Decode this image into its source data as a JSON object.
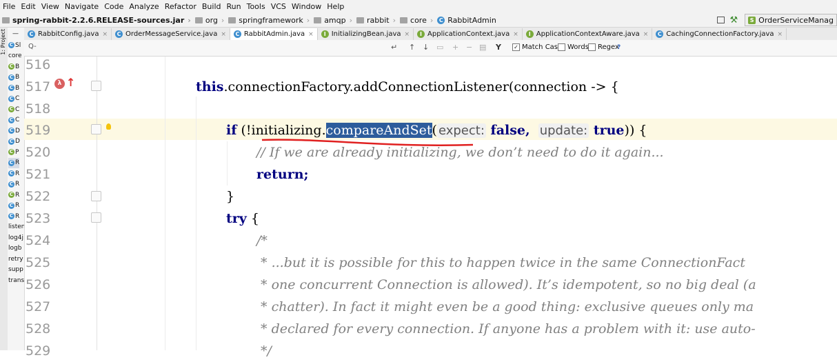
{
  "menu": [
    "File",
    "Edit",
    "View",
    "Navigate",
    "Code",
    "Analyze",
    "Refactor",
    "Build",
    "Run",
    "Tools",
    "VCS",
    "Window",
    "Help"
  ],
  "breadcrumbs": [
    "spring-rabbit-2.2.6.RELEASE-sources.jar",
    "org",
    "springframework",
    "amqp",
    "rabbit",
    "core",
    "RabbitAdmin"
  ],
  "run_config": "OrderServiceManag",
  "tool_window": {
    "label": "1: Project"
  },
  "project_tree": {
    "items": [
      "Sl",
      "core",
      "B",
      "B",
      "B",
      "C",
      "C",
      "C",
      "D",
      "D",
      "P",
      "R",
      "R",
      "R",
      "R",
      "R",
      "R",
      "listen",
      "log4j",
      "logb",
      "retry",
      "supp",
      "trans"
    ],
    "selected_index": 11
  },
  "tabs": [
    {
      "label": "RabbitConfig.java",
      "kind": "class",
      "active": false
    },
    {
      "label": "OrderMessageService.java",
      "kind": "class",
      "active": false
    },
    {
      "label": "RabbitAdmin.java",
      "kind": "class",
      "active": true
    },
    {
      "label": "InitializingBean.java",
      "kind": "interface",
      "active": false
    },
    {
      "label": "ApplicationContext.java",
      "kind": "interface",
      "active": false
    },
    {
      "label": "ApplicationContextAware.java",
      "kind": "interface",
      "active": false
    },
    {
      "label": "CachingConnectionFactory.java",
      "kind": "class",
      "active": false
    }
  ],
  "search": {
    "placeholder": "Q-",
    "match_case": {
      "label": "Match Case",
      "checked": true
    },
    "words": {
      "label": "Words",
      "checked": false
    },
    "regex": {
      "label": "Regex",
      "checked": false
    },
    "help": "?"
  },
  "line_numbers": [
    "516",
    "517",
    "518",
    "519",
    "520",
    "521",
    "522",
    "523",
    "524",
    "525",
    "526",
    "527",
    "528",
    "529"
  ],
  "code": {
    "l517": {
      "kw": "this",
      "rest": ".connectionFactory.addConnectionListener(connection -> {",
      "pre": "this",
      ".": "."
    },
    "l519": {
      "if": "if",
      "open": " (!initializing.",
      "method": "compareAndSet",
      "paren": "(",
      "hint1": "expect:",
      "val1": " false,",
      "hint2": "update:",
      "val2": " true",
      ")": ")) {"
    },
    "l520": "// If we are already initializing, we don’t need to do it again...",
    "l521": "return;",
    "l522": "}",
    "l523_kw": "try",
    "l523_rest": " {",
    "l524": "/*",
    "l525": " * ...but it is possible for this to happen twice in the same ConnectionFact",
    "l526": " * one concurrent Connection is allowed). It’s idempotent, so no big deal (a",
    "l527": " * chatter). In fact it might even be a good thing: exclusive queues only ma",
    "l528": " * declared for every connection. If anyone has a problem with it: use auto-",
    "l529": " */"
  }
}
